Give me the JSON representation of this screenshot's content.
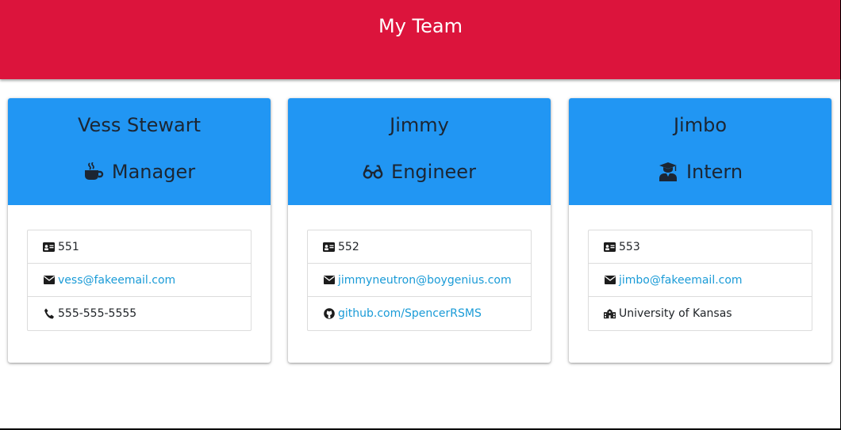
{
  "header": {
    "title": "My Team",
    "background": "#dc143c"
  },
  "theme": {
    "card_header": "#2196f3",
    "link": "#1a9bd7"
  },
  "cards": [
    {
      "name": "Vess Stewart",
      "role": "Manager",
      "role_icon": "coffee-icon",
      "items": [
        {
          "icon": "id-card-icon",
          "text": "551",
          "link": false
        },
        {
          "icon": "envelope-icon",
          "text": "vess@fakeemail.com",
          "link": true
        },
        {
          "icon": "phone-icon",
          "text": "555-555-5555",
          "link": false
        }
      ]
    },
    {
      "name": "Jimmy",
      "role": "Engineer",
      "role_icon": "glasses-icon",
      "items": [
        {
          "icon": "id-card-icon",
          "text": "552",
          "link": false
        },
        {
          "icon": "envelope-icon",
          "text": "jimmyneutron@boygenius.com",
          "link": true
        },
        {
          "icon": "github-icon",
          "text": "github.com/SpencerRSMS",
          "link": true
        }
      ]
    },
    {
      "name": "Jimbo",
      "role": "Intern",
      "role_icon": "graduate-icon",
      "items": [
        {
          "icon": "id-card-icon",
          "text": "553",
          "link": false
        },
        {
          "icon": "envelope-icon",
          "text": "jimbo@fakeemail.com",
          "link": true
        },
        {
          "icon": "university-icon",
          "text": "University of Kansas",
          "link": false
        }
      ]
    }
  ]
}
